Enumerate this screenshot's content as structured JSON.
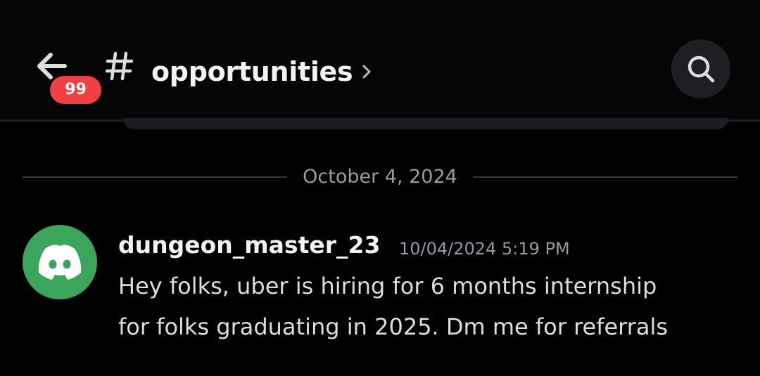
{
  "header": {
    "back_icon": "arrow-left-icon",
    "unread_badge": "99",
    "channel_icon": "hash-icon",
    "channel_name": "opportunities",
    "chevron_icon": "chevron-right-icon",
    "search_icon": "search-icon",
    "badge_color": "#f23f43"
  },
  "divider": {
    "date": "October 4, 2024"
  },
  "message": {
    "avatar_icon": "discord-logo-icon",
    "avatar_color": "#3ba55c",
    "author": "dungeon_master_23",
    "timestamp": "10/04/2024 5:19 PM",
    "lines": [
      "Hey folks, uber is hiring for 6 months internship",
      "for folks graduating in 2025. Dm me for referrals"
    ]
  }
}
